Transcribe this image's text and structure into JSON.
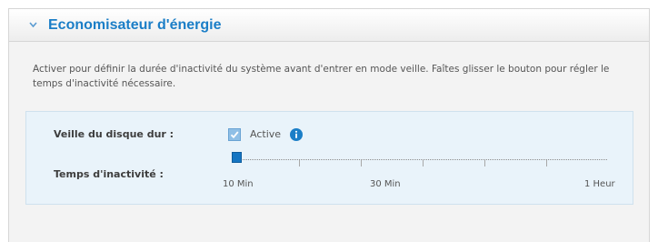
{
  "section": {
    "title": "Economisateur d'énergie",
    "description": "Activer pour définir la durée d'inactivité du système avant d'entrer en mode veille. Faîtes glisser le bouton pour régler le temps d'inactivité nécessaire."
  },
  "disk_sleep": {
    "label": "Veille du disque dur :",
    "checkbox_checked": true,
    "checkbox_text": "Active",
    "info_icon": "info-icon"
  },
  "idle_time": {
    "label": "Temps d'inactivité :",
    "slider_labels": [
      "10 Min",
      "30 Min",
      "1 Heur"
    ],
    "slider_steps": 6,
    "selected_step": 0
  },
  "colors": {
    "accent": "#1b7ec7",
    "slider_handle": "#1575c2",
    "settings_background": "#e9f3fa"
  }
}
